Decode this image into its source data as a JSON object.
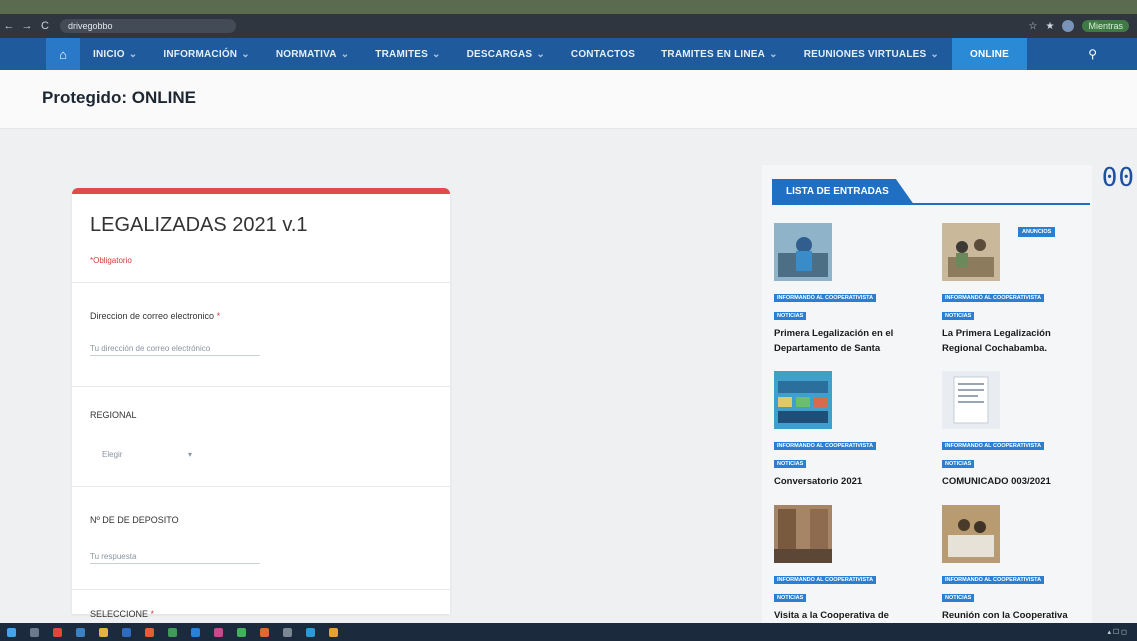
{
  "browser": {
    "url": "drivegobbo",
    "user": "Mientras"
  },
  "nav": {
    "home_icon": "home-icon",
    "items": [
      {
        "label": "INICIO",
        "dropdown": true
      },
      {
        "label": "INFORMACIÓN",
        "dropdown": true
      },
      {
        "label": "NORMATIVA",
        "dropdown": true
      },
      {
        "label": "TRAMITES",
        "dropdown": true
      },
      {
        "label": "DESCARGAS",
        "dropdown": true
      },
      {
        "label": "CONTACTOS",
        "dropdown": false
      },
      {
        "label": "TRAMITES EN LINEA",
        "dropdown": true
      },
      {
        "label": "REUNIONES VIRTUALES",
        "dropdown": true
      },
      {
        "label": "ONLINE",
        "dropdown": false,
        "active": true
      }
    ],
    "chevron": "⌄",
    "colors": {
      "bar": "#1f5b9c",
      "active": "#2b8ad6"
    }
  },
  "page": {
    "title": "Protegido: ONLINE",
    "counter": "00"
  },
  "form": {
    "title": "LEGALIZADAS 2021 v.1",
    "required_note": "*Obligatorio",
    "questions": [
      {
        "label": "Direccion de correo electronico",
        "required": true,
        "placeholder": "Tu dirección de correo electrónico"
      },
      {
        "label": "REGIONAL",
        "required": false,
        "placeholder": "Elegir"
      },
      {
        "label": "Nº DE DE DEPOSITO",
        "required": false,
        "placeholder": "Tu respuesta"
      },
      {
        "label": "SELECCIONE",
        "required": true
      }
    ],
    "required_mark": "*",
    "accent": "#e24b4b"
  },
  "sidebar": {
    "heading": "LISTA DE ENTRADAS",
    "entries": [
      {
        "categories": [
          "INFORMANDO AL COOPERATIVISTA",
          "NOTICIAS"
        ],
        "title": "Primera Legalización en el Departamento de Santa"
      },
      {
        "badge": "ANUNCIOS",
        "categories": [
          "INFORMANDO AL COOPERATIVISTA",
          "NOTICIAS"
        ],
        "title": "La Primera Legalización Regional Cochabamba."
      },
      {
        "categories": [
          "INFORMANDO AL COOPERATIVISTA",
          "NOTICIAS"
        ],
        "title": "Conversatorio 2021"
      },
      {
        "categories": [
          "INFORMANDO AL COOPERATIVISTA",
          "NOTICIAS"
        ],
        "title": "COMUNICADO 003/2021"
      },
      {
        "categories": [
          "INFORMANDO AL COOPERATIVISTA",
          "NOTICIAS"
        ],
        "title": "Visita a la Cooperativa de"
      },
      {
        "categories": [
          "INFORMANDO AL COOPERATIVISTA",
          "NOTICIAS"
        ],
        "title": "Reunión con la Cooperativa"
      }
    ]
  }
}
